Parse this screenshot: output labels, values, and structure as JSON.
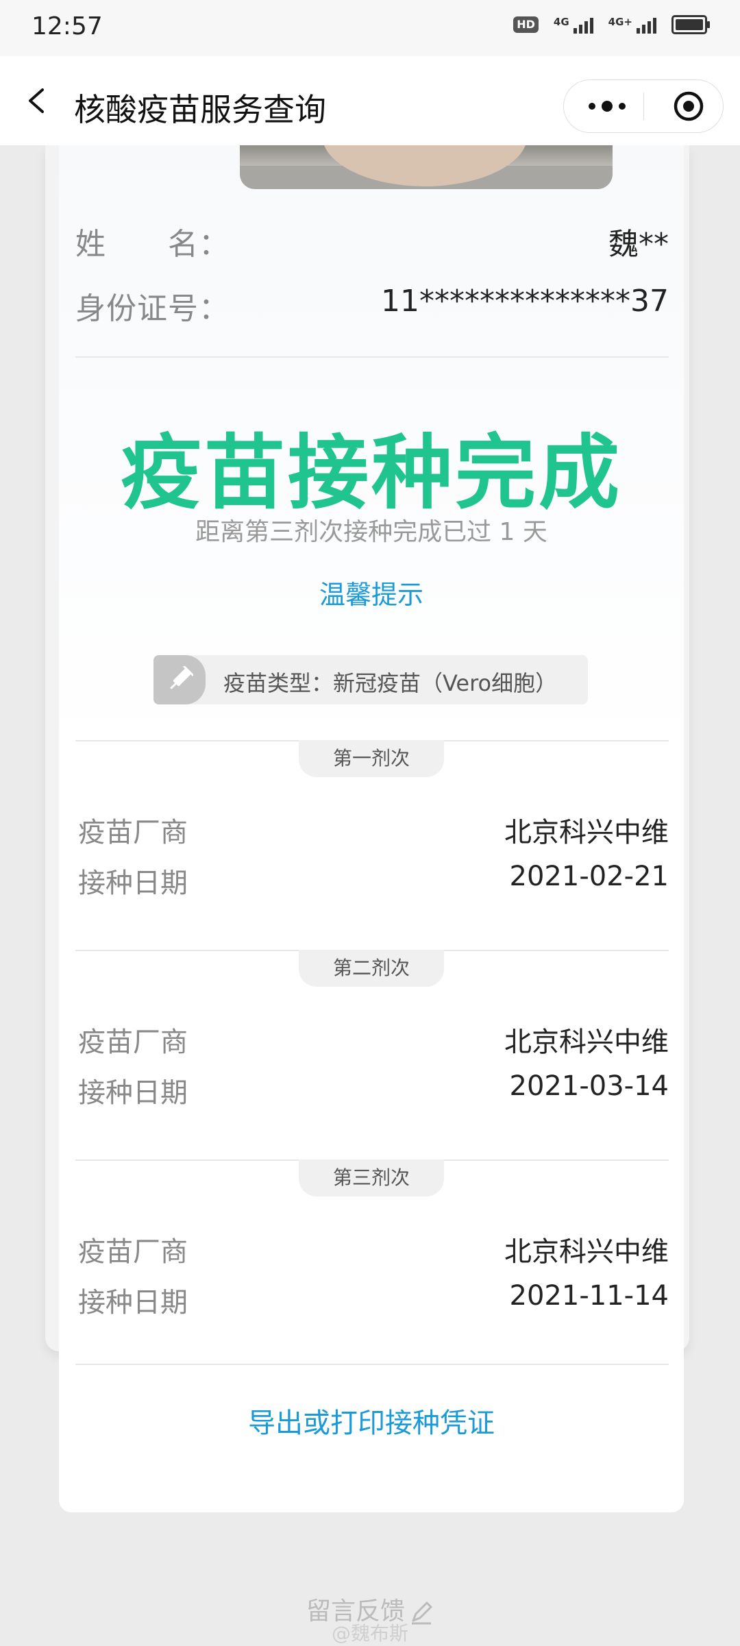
{
  "status_bar": {
    "time": "12:57",
    "hd_badge": "HD",
    "sim1_label": "4G",
    "sim2_label": "4G+"
  },
  "nav": {
    "title": "核酸疫苗服务查询"
  },
  "person": {
    "name_label": "姓　　名：",
    "name_value": "魏**",
    "id_label": "身份证号：",
    "id_value": "11**************37"
  },
  "status": {
    "title": "疫苗接种完成",
    "subtitle": "距离第三剂次接种完成已过 1 天",
    "tip_link": "温馨提示",
    "vaccine_type": "疫苗类型：新冠疫苗（Vero细胞）"
  },
  "doses": [
    {
      "label": "第一剂次",
      "maker_label": "疫苗厂商",
      "maker": "北京科兴中维",
      "date_label": "接种日期",
      "date": "2021-02-21"
    },
    {
      "label": "第二剂次",
      "maker_label": "疫苗厂商",
      "maker": "北京科兴中维",
      "date_label": "接种日期",
      "date": "2021-03-14"
    },
    {
      "label": "第三剂次",
      "maker_label": "疫苗厂商",
      "maker": "北京科兴中维",
      "date_label": "接种日期",
      "date": "2021-11-14"
    }
  ],
  "export_link": "导出或打印接种凭证",
  "feedback_link": "留言反馈",
  "watermark": "@魏布斯",
  "colors": {
    "accent_green": "#1fc48e",
    "link_blue": "#1b9ad8"
  }
}
